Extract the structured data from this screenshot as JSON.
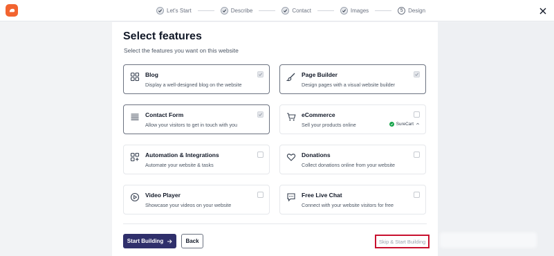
{
  "steps": [
    {
      "label": "Let's Start",
      "state": "done"
    },
    {
      "label": "Describe",
      "state": "done"
    },
    {
      "label": "Contact",
      "state": "done"
    },
    {
      "label": "Images",
      "state": "done"
    },
    {
      "label": "Design",
      "state": "current",
      "number": "5"
    }
  ],
  "page": {
    "title": "Select features",
    "subtitle": "Select the features you want on this website"
  },
  "features": [
    {
      "title": "Blog",
      "desc": "Display a well-designed blog on the website",
      "checked": true,
      "icon": "grid-icon"
    },
    {
      "title": "Page Builder",
      "desc": "Design pages with a visual website builder",
      "checked": true,
      "icon": "brush-icon"
    },
    {
      "title": "Contact Form",
      "desc": "Allow your visitors to get in touch with you",
      "checked": true,
      "icon": "form-lines-icon"
    },
    {
      "title": "eCommerce",
      "desc": "Sell your products online",
      "checked": false,
      "icon": "cart-icon",
      "badge": "SureCart"
    },
    {
      "title": "Automation & Integrations",
      "desc": "Automate your website & tasks",
      "checked": false,
      "icon": "apps-plus-icon"
    },
    {
      "title": "Donations",
      "desc": "Collect donations online from your website",
      "checked": false,
      "icon": "heart-icon"
    },
    {
      "title": "Video Player",
      "desc": "Showcase your videos on your website",
      "checked": false,
      "icon": "play-circle-icon"
    },
    {
      "title": "Free Live Chat",
      "desc": "Connect with your website visitors for free",
      "checked": false,
      "icon": "chat-icon"
    }
  ],
  "actions": {
    "start_label": "Start Building",
    "back_label": "Back",
    "skip_label": "Skip & Start Building"
  },
  "colors": {
    "brand": "#f26430",
    "primary_button": "#2f2f6b",
    "highlight_box": "#c8102e",
    "badge_green": "#16a34a"
  }
}
